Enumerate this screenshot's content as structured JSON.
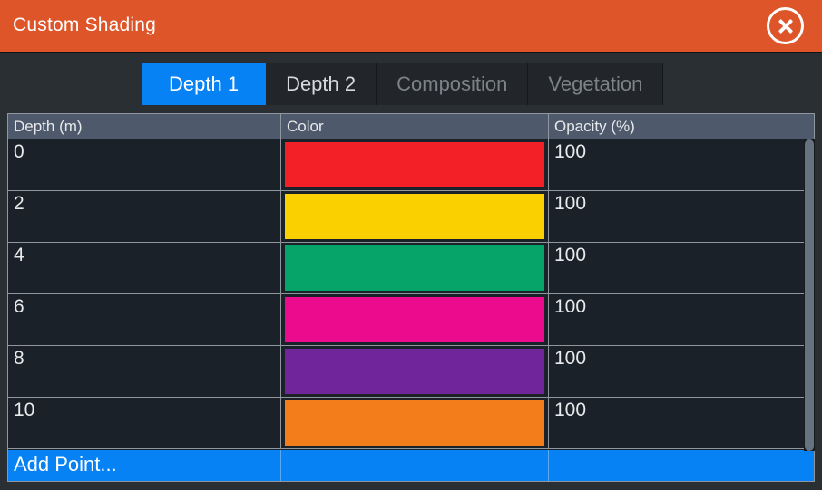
{
  "window": {
    "title": "Custom Shading",
    "close_icon": "close-circle-icon",
    "titlebar_color": "#dd5529"
  },
  "tabs": [
    {
      "label": "Depth 1",
      "state": "selected"
    },
    {
      "label": "Depth 2",
      "state": "normal"
    },
    {
      "label": "Composition",
      "state": "disabled"
    },
    {
      "label": "Vegetation",
      "state": "disabled"
    }
  ],
  "table": {
    "columns": [
      "Depth (m)",
      "Color",
      "Opacity (%)"
    ],
    "rows": [
      {
        "depth": "0",
        "color": "#f42028",
        "opacity": "100"
      },
      {
        "depth": "2",
        "color": "#fbd000",
        "opacity": "100"
      },
      {
        "depth": "4",
        "color": "#06a468",
        "opacity": "100"
      },
      {
        "depth": "6",
        "color": "#ec0b8c",
        "opacity": "100"
      },
      {
        "depth": "8",
        "color": "#70259b",
        "opacity": "100"
      },
      {
        "depth": "10",
        "color": "#f47d1b",
        "opacity": "100"
      }
    ],
    "add_row_label": "Add Point...",
    "selected_row": "add-point"
  },
  "scrollbar": {
    "orientation": "vertical",
    "thumb_color": "#66727f"
  },
  "colors": {
    "accent_blue": "#0782f4",
    "header_row": "#4e5a6b",
    "cell_background": "#1a2128",
    "grid_line": "#8f969d",
    "window_background": "#2a2f33"
  }
}
